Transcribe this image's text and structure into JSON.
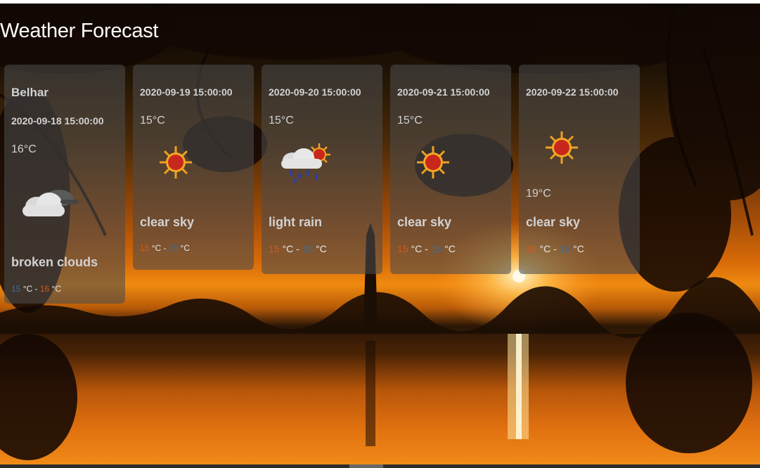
{
  "page": {
    "title": "Weather Forecast"
  },
  "colors": {
    "hot": "#d2591d",
    "cold": "#3a6e9a",
    "card_text": "#d2d2d2"
  },
  "current": {
    "city": "Belhar",
    "date": "2020-09-18 15:00:00",
    "temp": "16°C",
    "icon": "broken-clouds-icon",
    "desc": "broken clouds",
    "range_low": "15",
    "range_high": "16",
    "unit": "°C",
    "separator": " - "
  },
  "forecast": [
    {
      "date": "2020-09-19 15:00:00",
      "temp": "15°C",
      "icon": "clear-sky-icon",
      "desc": "clear sky",
      "range_high": "15",
      "range_low": "15",
      "unit": "°C",
      "separator": " - "
    },
    {
      "date": "2020-09-20 15:00:00",
      "temp": "15°C",
      "icon": "light-rain-icon",
      "desc": "light rain",
      "range_high": "15",
      "range_low": "15",
      "unit": "°C",
      "separator": " - "
    },
    {
      "date": "2020-09-21 15:00:00",
      "temp": "15°C",
      "icon": "clear-sky-icon",
      "desc": "clear sky",
      "range_high": "15",
      "range_low": "15",
      "unit": "°C",
      "separator": " - "
    },
    {
      "date": "2020-09-22 15:00:00",
      "temp": "19°C",
      "icon": "clear-sky-icon",
      "desc": "clear sky",
      "range_high": "19",
      "range_low": "19",
      "unit": "°C",
      "separator": " - "
    }
  ]
}
